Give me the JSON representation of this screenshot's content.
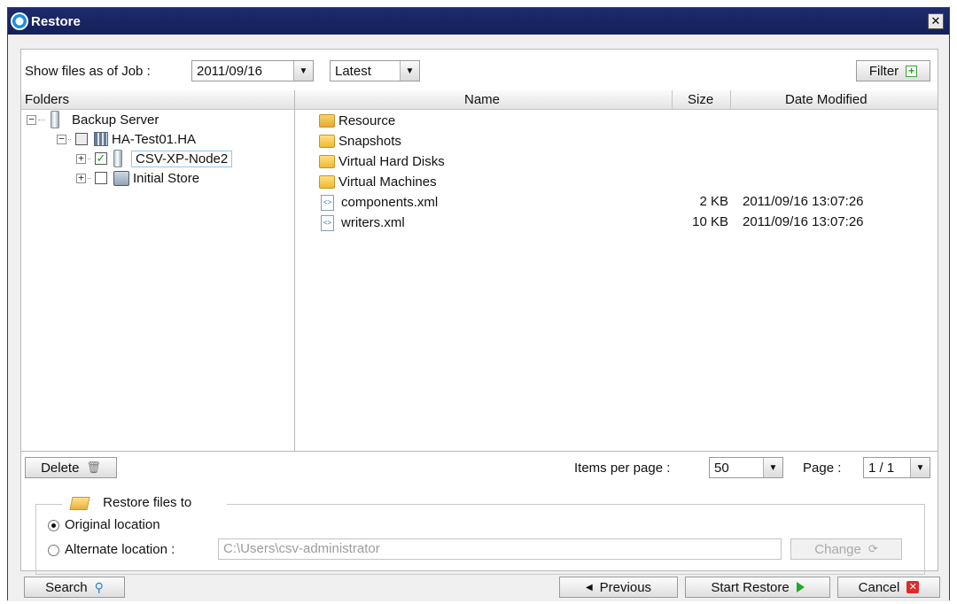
{
  "window": {
    "title": "Restore",
    "close_glyph": "✕"
  },
  "toolbar": {
    "show_files_label": "Show files as of Job :",
    "job_date_value": "2011/09/16",
    "version_value": "Latest",
    "filter_label": "Filter"
  },
  "columns": {
    "folders": "Folders",
    "name": "Name",
    "size": "Size",
    "date_modified": "Date Modified"
  },
  "tree": {
    "root": {
      "label": "Backup Server",
      "expander": "−"
    },
    "cluster": {
      "label": "HA-Test01.HA",
      "expander": "−"
    },
    "node": {
      "label": "CSV-XP-Node2",
      "expander": "+",
      "checked": true
    },
    "store": {
      "label": "Initial Store",
      "expander": "+",
      "checked": false
    }
  },
  "files": [
    {
      "name": "Resource",
      "type": "folder",
      "size": "",
      "date": ""
    },
    {
      "name": "Snapshots",
      "type": "folder",
      "size": "",
      "date": ""
    },
    {
      "name": "Virtual Hard Disks",
      "type": "folder",
      "size": "",
      "date": ""
    },
    {
      "name": "Virtual Machines",
      "type": "folder",
      "size": "",
      "date": ""
    },
    {
      "name": "components.xml",
      "type": "xml",
      "size": "2 KB",
      "date": "2011/09/16 13:07:26"
    },
    {
      "name": "writers.xml",
      "type": "xml",
      "size": "10 KB",
      "date": "2011/09/16 13:07:26"
    }
  ],
  "pagination": {
    "delete_label": "Delete",
    "items_per_page_label": "Items per page :",
    "items_per_page_value": "50",
    "page_label": "Page :",
    "page_value": "1 / 1"
  },
  "restore": {
    "section_title": "Restore files to",
    "original_label": "Original location",
    "alternate_label": "Alternate location :",
    "alternate_path": "C:\\Users\\csv-administrator",
    "change_label": "Change",
    "selected": "original"
  },
  "footer": {
    "search_label": "Search",
    "previous_label": "Previous",
    "start_restore_label": "Start Restore",
    "cancel_label": "Cancel"
  },
  "colors": {
    "titlebar": "#1e2b6c",
    "check": "#1a9a1a",
    "cancel_icon": "#e02a2a",
    "accent_selection": "#8fc6ef"
  }
}
